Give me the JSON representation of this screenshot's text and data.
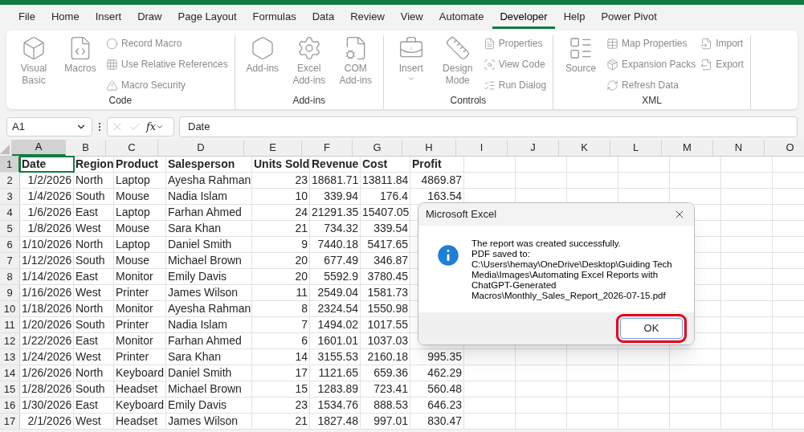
{
  "menu_tabs": [
    {
      "label": "File",
      "selected": false
    },
    {
      "label": "Home",
      "selected": false
    },
    {
      "label": "Insert",
      "selected": false
    },
    {
      "label": "Draw",
      "selected": false
    },
    {
      "label": "Page Layout",
      "selected": false
    },
    {
      "label": "Formulas",
      "selected": false
    },
    {
      "label": "Data",
      "selected": false
    },
    {
      "label": "Review",
      "selected": false
    },
    {
      "label": "View",
      "selected": false
    },
    {
      "label": "Automate",
      "selected": false
    },
    {
      "label": "Developer",
      "selected": true
    },
    {
      "label": "Help",
      "selected": false
    },
    {
      "label": "Power Pivot",
      "selected": false
    }
  ],
  "ribbon_groups": [
    {
      "label": "Code",
      "large": [
        {
          "label": "Visual Basic",
          "dropdown": false
        },
        {
          "label": "Macros",
          "dropdown": false
        }
      ],
      "small_columns": [
        [
          "Record Macro",
          "Use Relative References",
          "Macro Security"
        ]
      ]
    },
    {
      "label": "Add-ins",
      "large": [
        {
          "label": "Add-ins",
          "dropdown": false
        },
        {
          "label": "Excel Add-ins",
          "dropdown": false
        },
        {
          "label": "COM Add-ins",
          "dropdown": false
        }
      ]
    },
    {
      "label": "Controls",
      "large": [
        {
          "label": "Insert",
          "dropdown": true
        },
        {
          "label": "Design Mode",
          "dropdown": false
        }
      ],
      "small_columns": [
        [
          "Properties",
          "View Code",
          "Run Dialog"
        ]
      ]
    },
    {
      "label": "XML",
      "large": [
        {
          "label": "Source",
          "dropdown": false
        }
      ],
      "small_columns": [
        [
          "Map Properties",
          "Expansion Packs",
          "Refresh Data"
        ],
        [
          "Import",
          "Export"
        ]
      ]
    }
  ],
  "formula_bar": {
    "name_box": "A1",
    "fx": "fx",
    "value": "Date"
  },
  "sheet": {
    "columns": [
      {
        "label": "A",
        "selected": true
      },
      {
        "label": "B",
        "selected": false
      },
      {
        "label": "C",
        "selected": false
      },
      {
        "label": "D",
        "selected": false
      },
      {
        "label": "E",
        "selected": false
      },
      {
        "label": "F",
        "selected": false
      },
      {
        "label": "G",
        "selected": false
      },
      {
        "label": "H",
        "selected": false
      },
      {
        "label": "I",
        "selected": false
      },
      {
        "label": "J",
        "selected": false
      },
      {
        "label": "K",
        "selected": false
      },
      {
        "label": "L",
        "selected": false
      },
      {
        "label": "M",
        "selected": false
      },
      {
        "label": "N",
        "selected": false
      },
      {
        "label": "O",
        "selected": false
      }
    ],
    "rows": [
      {
        "number": "1",
        "selected": true,
        "header": true,
        "cells": [
          "Date",
          "Region",
          "Product",
          "Salesperson",
          "Units Sold",
          "Revenue",
          "Cost",
          "Profit"
        ]
      },
      {
        "number": "2",
        "selected": false,
        "header": false,
        "cells": [
          "1/2/2026",
          "North",
          "Laptop",
          "Ayesha Rahman",
          "23",
          "18681.71",
          "13811.84",
          "4869.87"
        ]
      },
      {
        "number": "3",
        "selected": false,
        "header": false,
        "cells": [
          "1/4/2026",
          "South",
          "Mouse",
          "Nadia Islam",
          "10",
          "339.94",
          "176.4",
          "163.54"
        ]
      },
      {
        "number": "4",
        "selected": false,
        "header": false,
        "cells": [
          "1/6/2026",
          "East",
          "Laptop",
          "Farhan Ahmed",
          "24",
          "21291.35",
          "15407.05"
        ]
      },
      {
        "number": "5",
        "selected": false,
        "header": false,
        "cells": [
          "1/8/2026",
          "West",
          "Mouse",
          "Sara Khan",
          "21",
          "734.32",
          "339.54"
        ]
      },
      {
        "number": "6",
        "selected": false,
        "header": false,
        "cells": [
          "1/10/2026",
          "North",
          "Laptop",
          "Daniel Smith",
          "9",
          "7440.18",
          "5417.65"
        ]
      },
      {
        "number": "7",
        "selected": false,
        "header": false,
        "cells": [
          "1/12/2026",
          "South",
          "Mouse",
          "Michael Brown",
          "20",
          "677.49",
          "346.87"
        ]
      },
      {
        "number": "8",
        "selected": false,
        "header": false,
        "cells": [
          "1/14/2026",
          "East",
          "Monitor",
          "Emily Davis",
          "20",
          "5592.9",
          "3780.45"
        ]
      },
      {
        "number": "9",
        "selected": false,
        "header": false,
        "cells": [
          "1/16/2026",
          "West",
          "Printer",
          "James Wilson",
          "11",
          "2549.04",
          "1581.73"
        ]
      },
      {
        "number": "10",
        "selected": false,
        "header": false,
        "cells": [
          "1/18/2026",
          "North",
          "Monitor",
          "Ayesha Rahman",
          "8",
          "2324.54",
          "1550.98"
        ]
      },
      {
        "number": "11",
        "selected": false,
        "header": false,
        "cells": [
          "1/20/2026",
          "South",
          "Printer",
          "Nadia Islam",
          "7",
          "1494.02",
          "1017.55"
        ]
      },
      {
        "number": "12",
        "selected": false,
        "header": false,
        "cells": [
          "1/22/2026",
          "East",
          "Monitor",
          "Farhan Ahmed",
          "6",
          "1601.01",
          "1037.03"
        ]
      },
      {
        "number": "13",
        "selected": false,
        "header": false,
        "cells": [
          "1/24/2026",
          "West",
          "Printer",
          "Sara Khan",
          "14",
          "3155.53",
          "2160.18",
          "995.35"
        ]
      },
      {
        "number": "14",
        "selected": false,
        "header": false,
        "cells": [
          "1/26/2026",
          "North",
          "Keyboard",
          "Daniel Smith",
          "17",
          "1121.65",
          "659.36",
          "462.29"
        ]
      },
      {
        "number": "15",
        "selected": false,
        "header": false,
        "cells": [
          "1/28/2026",
          "South",
          "Headset",
          "Michael Brown",
          "15",
          "1283.89",
          "723.41",
          "560.48"
        ]
      },
      {
        "number": "16",
        "selected": false,
        "header": false,
        "cells": [
          "1/30/2026",
          "East",
          "Keyboard",
          "Emily Davis",
          "23",
          "1534.76",
          "888.53",
          "646.23"
        ]
      },
      {
        "number": "17",
        "selected": false,
        "header": false,
        "cells": [
          "2/1/2026",
          "West",
          "Headset",
          "James Wilson",
          "21",
          "1827.48",
          "997.01",
          "830.47"
        ]
      }
    ]
  },
  "dialog": {
    "title": "Microsoft Excel",
    "message": [
      "The report was created successfully.",
      "PDF saved to:",
      "C:\\Users\\hemay\\OneDrive\\Desktop\\Guiding Tech",
      "Media\\Images\\Automating Excel Reports with",
      "ChatGPT-Generated",
      "Macros\\Monthly_Sales_Report_2026-07-15.pdf"
    ],
    "button": {
      "label": "OK",
      "highlighted": true
    }
  }
}
